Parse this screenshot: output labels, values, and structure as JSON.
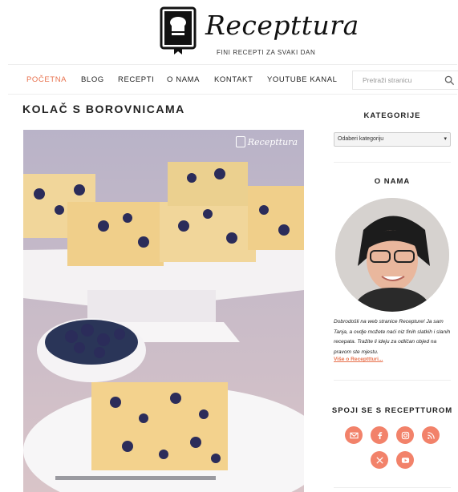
{
  "brand": {
    "name": "Recepttura",
    "tagline": "FINI RECEPTI ZA SVAKI DAN",
    "accent": "#e8714d"
  },
  "nav": {
    "items": [
      "POČETNA",
      "BLOG",
      "RECEPTI",
      "O NAMA",
      "KONTAKT",
      "YOUTUBE KANAL"
    ],
    "active_index": 0,
    "search_placeholder": "Pretraži stranicu"
  },
  "post": {
    "title": "KOLAČ S BOROVNICAMA",
    "watermark": "Recepttura"
  },
  "sidebar": {
    "categories": {
      "title": "KATEGORIJE",
      "select_value": "Odaberi kategoriju"
    },
    "about": {
      "title": "O NAMA",
      "text": "Dobrodošli na web stranice Recepture! Ja sam Tanja, a ovdje možete naći niz finih slatkih i slanih recepata. Tražite li ideju za odličan objed na pravom ste mjestu.",
      "link": "Više o Recepttturi..."
    },
    "social": {
      "title": "SPOJI SE S RECEPTTUROM",
      "icons": [
        "email-icon",
        "facebook-icon",
        "instagram-icon",
        "rss-icon",
        "x-icon",
        "youtube-icon"
      ]
    }
  }
}
